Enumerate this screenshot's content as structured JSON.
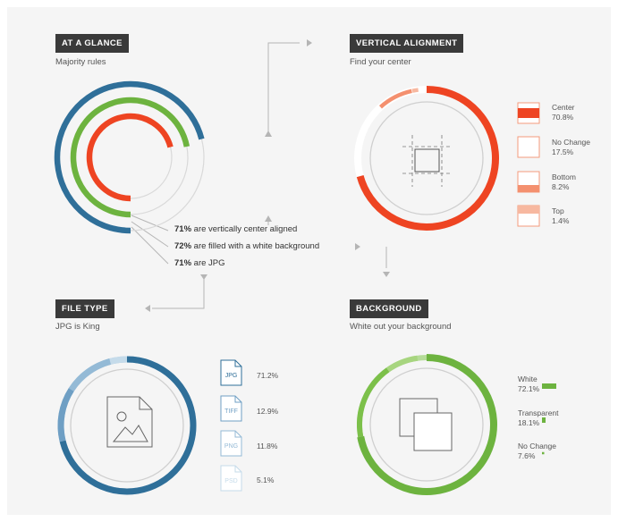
{
  "colors": {
    "blue": "#2f6f99",
    "green": "#6db33f",
    "red": "#ee4422",
    "orange": "#f07150",
    "lightgray": "#e2e2e2",
    "arrow": "#b5b5b5"
  },
  "glance": {
    "header": "AT A GLANCE",
    "subtitle": "Majority rules"
  },
  "vertical": {
    "header": "VERTICAL ALIGNMENT",
    "subtitle": "Find your center"
  },
  "filetype": {
    "header": "FILE TYPE",
    "subtitle": "JPG is King"
  },
  "background": {
    "header": "BACKGROUND",
    "subtitle": "White out your background"
  },
  "stats": [
    {
      "pct": "71%",
      "text": " are vertically center aligned"
    },
    {
      "pct": "72%",
      "text": " are filled with a white background"
    },
    {
      "pct": "71%",
      "text": " are JPG"
    }
  ],
  "chart_data": [
    {
      "type": "radial-bar",
      "title": "AT A GLANCE",
      "series": [
        {
          "label": "Center aligned",
          "value": 71,
          "color": "#ee4422"
        },
        {
          "label": "White background",
          "value": 72,
          "color": "#6db33f"
        },
        {
          "label": "JPG",
          "value": 71,
          "color": "#2f6f99"
        }
      ]
    },
    {
      "type": "pie",
      "title": "VERTICAL ALIGNMENT",
      "categories": [
        "Center",
        "No Change",
        "Bottom",
        "Top"
      ],
      "values": [
        70.8,
        17.5,
        8.2,
        1.4
      ],
      "labels": [
        "70.8%",
        "17.5%",
        "8.2%",
        "1.4%"
      ]
    },
    {
      "type": "pie",
      "title": "FILE TYPE",
      "categories": [
        "JPG",
        "TIFF",
        "PNG",
        "PSD"
      ],
      "values": [
        71.2,
        12.9,
        11.8,
        5.1
      ],
      "labels": [
        "71.2%",
        "12.9%",
        "11.8%",
        "5.1%"
      ]
    },
    {
      "type": "pie",
      "title": "BACKGROUND",
      "categories": [
        "White",
        "Transparent",
        "No Change"
      ],
      "values": [
        72.1,
        18.1,
        7.6
      ],
      "labels": [
        "72.1%",
        "18.1%",
        "7.6%"
      ]
    }
  ]
}
